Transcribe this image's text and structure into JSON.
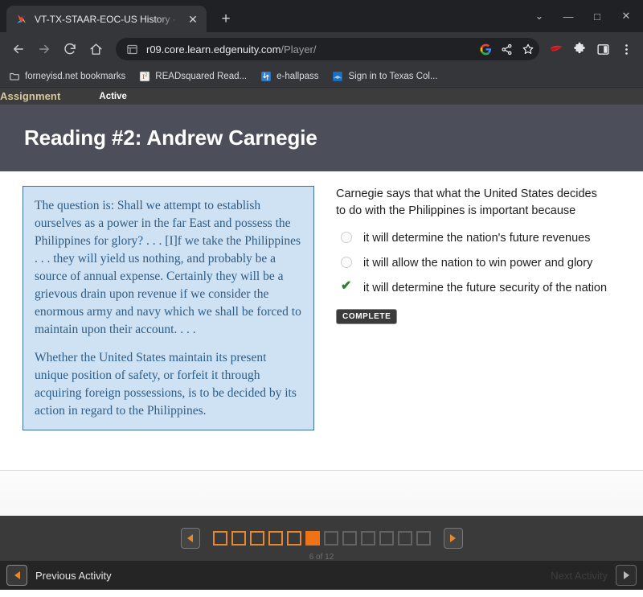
{
  "browser": {
    "tab": {
      "title": "VT-TX-STAAR-EOC-US History - In",
      "favicon_icon": "x-star-favicon",
      "close_icon": "close-icon"
    },
    "new_tab_icon": "plus-icon",
    "window_controls": {
      "more_icon": "chevron-down-icon",
      "minimize_icon": "minimize-icon",
      "maximize_icon": "maximize-icon",
      "close_icon": "close-icon"
    },
    "toolbar": {
      "back_icon": "back-arrow-icon",
      "forward_icon": "forward-arrow-icon",
      "reload_icon": "reload-icon",
      "home_icon": "home-icon",
      "site_info_icon": "page-info-icon",
      "url_host": "r09.core.learn.edgenuity.com",
      "url_path": "/Player/",
      "google_icon": "google-g-icon",
      "share_icon": "share-icon",
      "bookmark_star_icon": "star-icon",
      "extension_icon": "red-wing-extension-icon",
      "extensions_puzzle_icon": "puzzle-piece-icon",
      "side_panel_icon": "side-panel-icon",
      "menu_icon": "three-dot-menu-icon"
    },
    "bookmarks": [
      {
        "label": "forneyisd.net bookmarks",
        "icon": "folder-icon"
      },
      {
        "label": "READsquared Read...",
        "icon": "readsquared-icon"
      },
      {
        "label": "e-hallpass",
        "icon": "e-hallpass-icon"
      },
      {
        "label": "Sign in to Texas Col...",
        "icon": "texas-college-icon"
      }
    ]
  },
  "player": {
    "status": {
      "type_label": "Assignment",
      "state_label": "Active"
    },
    "lesson_title": "Reading #2: Andrew Carnegie",
    "passage": {
      "paragraphs": [
        "The question is: Shall we attempt to establish ourselves as a power in the far East and possess the Philippines for glory? . . . [I]f we take the Philippines . . . they will yield us nothing, and probably be a source of annual expense. Certainly they will be a grievous drain upon revenue if we consider the enormous army and navy which we shall be forced to maintain upon their account. . . .",
        "Whether the United States maintain its present unique position of safety, or forfeit it through acquiring foreign possessions, is to be decided by its action in regard to the Philippines."
      ]
    },
    "question": {
      "prompt": "Carnegie says that what the United States decides to do with the Philippines is important because",
      "options": [
        {
          "label": "it will determine the nation's future revenues",
          "state": "unselected"
        },
        {
          "label": "it will allow the nation to win power and glory",
          "state": "unselected"
        },
        {
          "label": "it will determine the future security of the nation",
          "state": "correct"
        }
      ],
      "status_badge": "COMPLETE"
    },
    "pager": {
      "prev_icon": "pager-left-arrow-icon",
      "next_icon": "pager-right-arrow-icon",
      "current_index": 6,
      "total": 12,
      "steps": [
        "done",
        "done",
        "done",
        "done",
        "done",
        "current",
        "todo",
        "todo",
        "todo",
        "todo",
        "todo",
        "todo"
      ]
    },
    "bottom_nav": {
      "previous_label": "Previous Activity",
      "previous_icon": "left-arrow-icon",
      "next_label": "Next Activity",
      "next_icon": "right-arrow-icon",
      "next_disabled": true
    }
  },
  "colors": {
    "accent_orange": "#ef7215",
    "status_gold": "#d8c89a",
    "quote_bg": "#cfe2f3",
    "quote_text": "#2c5d87",
    "correct_green": "#2e7d32"
  }
}
